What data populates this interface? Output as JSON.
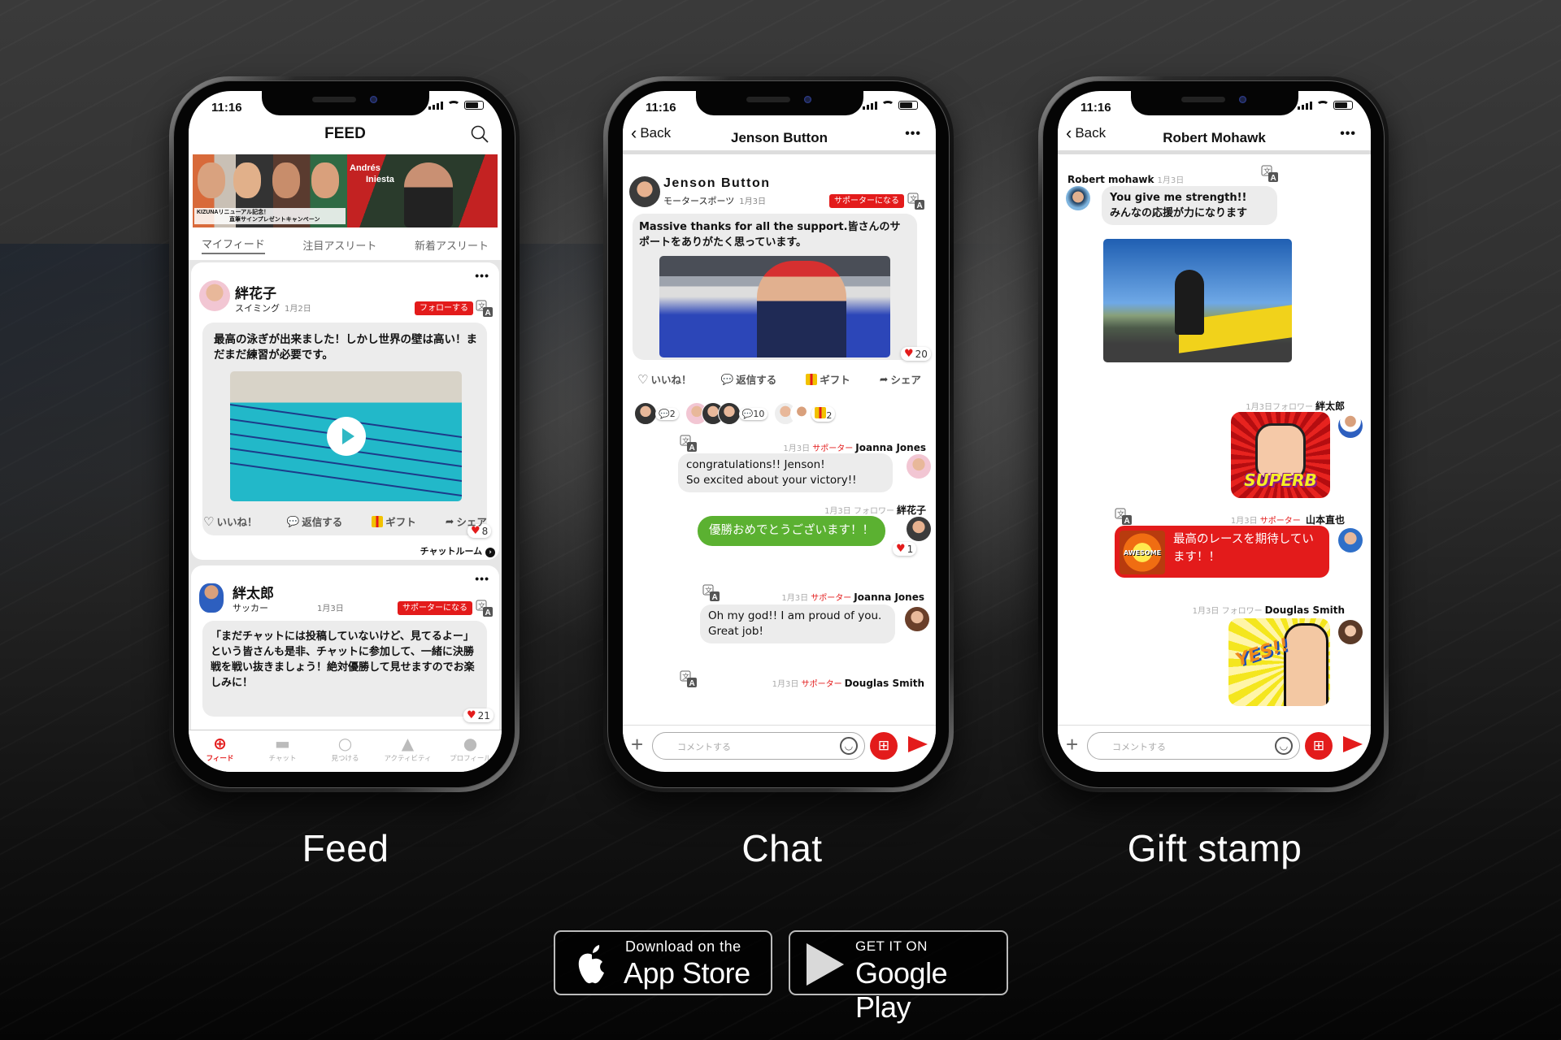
{
  "status_bar": {
    "time": "11:16"
  },
  "feed_phone": {
    "title": "FEED",
    "banner": {
      "campaign_caption_line1": "KIZUNAリニューアル記念！",
      "campaign_caption_line2": "直筆サインプレゼントキャンペーン",
      "featured_name_line1": "Andrés",
      "featured_name_line2": "Iniesta"
    },
    "tabs": [
      {
        "label": "マイフィード",
        "active": true
      },
      {
        "label": "注目アスリート",
        "active": false
      },
      {
        "label": "新着アスリート",
        "active": false
      }
    ],
    "posts": [
      {
        "name": "絆花子",
        "category": "スイミング",
        "date": "1月2日",
        "action_button": "フォローする",
        "text": "最高の泳ぎが出来ました！しかし世界の壁は高い！まだまだ練習が必要です。",
        "likes": "8",
        "has_video": true
      },
      {
        "name": "絆太郎",
        "category": "サッカー",
        "date": "1月3日",
        "action_button": "サポーターになる",
        "text": "「まだチャットには投稿していないけど、見てるよー」という皆さんも是非、チャットに参加して、一緒に決勝戦を戦い抜きましょう！絶対優勝して見せますのでお楽しみに！",
        "likes": "21"
      }
    ],
    "actions": {
      "like": "いいね！",
      "reply": "返信する",
      "gift": "ギフト",
      "share": "シェア"
    },
    "chatroom_link": "チャットルーム",
    "tabbar": [
      {
        "label": "フィード",
        "icon": "globe-icon",
        "active": true
      },
      {
        "label": "チャット",
        "icon": "chat-bubble-icon",
        "active": false
      },
      {
        "label": "見つける",
        "icon": "search-icon",
        "active": false
      },
      {
        "label": "アクティビティ",
        "icon": "bell-icon",
        "active": false
      },
      {
        "label": "プロフィール",
        "icon": "person-icon",
        "active": false
      }
    ]
  },
  "chat_phone": {
    "back_label": "Back",
    "title": "Jenson Button",
    "post": {
      "name": "Jenson Button",
      "category": "モータースポーツ",
      "date": "1月3日",
      "action_button": "サポーターになる",
      "text": "Massive thanks for all the support.皆さんのサポートをありがたく思っています。",
      "likes": "20"
    },
    "actions": {
      "like": "いいね！",
      "reply": "返信する",
      "gift": "ギフト",
      "share": "シェア"
    },
    "reaction_counts": [
      {
        "type": "reply",
        "count": "2"
      },
      {
        "type": "reply",
        "count": "10"
      },
      {
        "type": "gift",
        "count": "2"
      }
    ],
    "messages": [
      {
        "date": "1月3日",
        "role": "サポーター",
        "name": "Joanna Jones",
        "text_line1": "congratulations!! Jenson!",
        "text_line2": "So excited about your victory!!"
      },
      {
        "date": "1月3日",
        "role": "フォロワー",
        "name": "絆花子",
        "text": "優勝おめでとうございます！！",
        "likes": "1"
      },
      {
        "date": "1月3日",
        "role": "サポーター",
        "name": "Joanna Jones",
        "text_line1": "Oh my god!! I am proud of you.",
        "text_line2": "Great job!"
      },
      {
        "date": "1月3日",
        "role": "サポーター",
        "name": "Douglas Smith"
      }
    ],
    "input_placeholder": "コメントする"
  },
  "gift_phone": {
    "back_label": "Back",
    "title": "Robert Mohawk",
    "messages": [
      {
        "name": "Robert mohawk",
        "date": "1月3日",
        "text_line1": "You give me strength!!",
        "text_line2": "みんなの応援が力になります"
      },
      {
        "date": "1月3日",
        "role": "フォロワー",
        "name": "絆太郎",
        "stamp": "SUPERB"
      },
      {
        "date": "1月3日",
        "role": "サポーター",
        "name": "山本直也",
        "stamp": "AWESOME",
        "text": "最高のレースを期待しています！！"
      },
      {
        "date": "1月3日",
        "role": "フォロワー",
        "name": "Douglas Smith",
        "stamp": "YES!!"
      }
    ],
    "input_placeholder": "コメントする"
  },
  "captions": {
    "feed": "Feed",
    "chat": "Chat",
    "gift": "Gift stamp"
  },
  "stores": {
    "apple": {
      "small": "Download on the",
      "big": "App Store"
    },
    "google": {
      "small": "GET IT ON",
      "big": "Google Play"
    }
  },
  "colors": {
    "accent_red": "#e31b1b",
    "chat_green": "#5bb131",
    "background": "#2b2b2b"
  }
}
